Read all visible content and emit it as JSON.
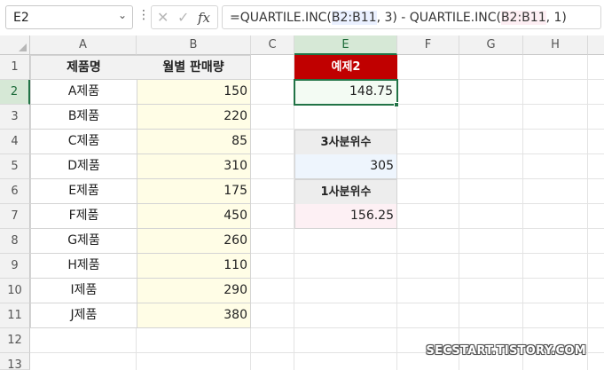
{
  "formula_bar": {
    "name_box": "E2",
    "name_box_arrow": "⌄",
    "more_icon": "⋮",
    "cancel_icon": "✕",
    "enter_icon": "✓",
    "fx_label": "fx",
    "formula_prefix": "=QUARTILE.INC(",
    "formula_ref1": "B2:B11",
    "formula_mid": ", 3) - QUARTILE.INC(",
    "formula_ref2": "B2:B11",
    "formula_suffix": ", 1)"
  },
  "columns": [
    "A",
    "B",
    "C",
    "E",
    "F",
    "G",
    "H"
  ],
  "selected_column": "E",
  "rows": [
    "1",
    "2",
    "3",
    "4",
    "5",
    "6",
    "7",
    "8",
    "9",
    "10",
    "11",
    "12",
    "13"
  ],
  "selected_row": "2",
  "table": {
    "headers": [
      "제품명",
      "월별 판매량"
    ],
    "rows": [
      {
        "name": "A제품",
        "sales": "150"
      },
      {
        "name": "B제품",
        "sales": "220"
      },
      {
        "name": "C제품",
        "sales": "85"
      },
      {
        "name": "D제품",
        "sales": "310"
      },
      {
        "name": "E제품",
        "sales": "175"
      },
      {
        "name": "F제품",
        "sales": "450"
      },
      {
        "name": "G제품",
        "sales": "260"
      },
      {
        "name": "H제품",
        "sales": "110"
      },
      {
        "name": "I제품",
        "sales": "290"
      },
      {
        "name": "J제품",
        "sales": "380"
      }
    ]
  },
  "example": {
    "title": "예제2",
    "value": "148.75"
  },
  "quartiles": {
    "q3_label": "3사분위수",
    "q3_value": "305",
    "q1_label": "1사분위수",
    "q1_value": "156.25"
  },
  "watermark": "SECSTART.TISTORY.COM",
  "colors": {
    "example_header": "#c00000",
    "selection": "#217346",
    "sales_fill": "#fffde6"
  }
}
